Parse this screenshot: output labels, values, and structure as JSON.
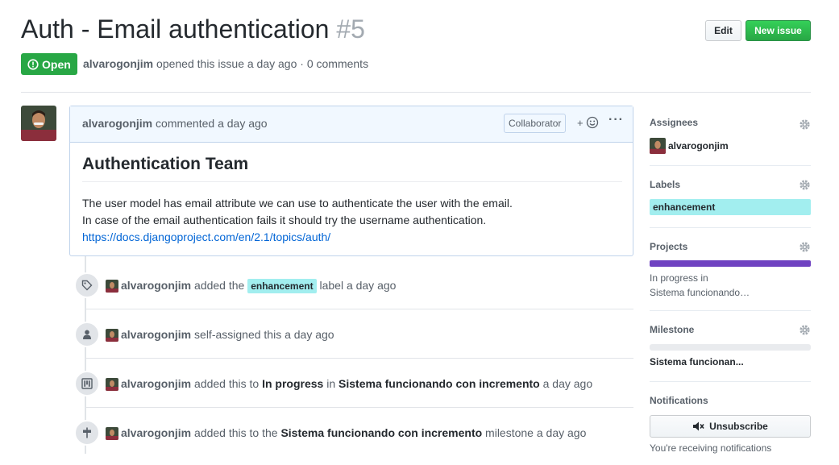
{
  "header": {
    "title": "Auth - Email authentication",
    "number": "#5",
    "edit_label": "Edit",
    "new_issue_label": "New issue",
    "state_label": "Open",
    "author": "alvarogonjim",
    "meta_text": "opened this issue a day ago · 0 comments"
  },
  "comment": {
    "author": "alvarogonjim",
    "meta": "commented a day ago",
    "role": "Collaborator",
    "react": "+",
    "heading": "Authentication Team",
    "line1": "The user model has email attribute we can use to authenticate the user with the email.",
    "line2": "In case of the email authentication fails it should try the username authentication.",
    "link": "https://docs.djangoproject.com/en/2.1/topics/auth/"
  },
  "timeline": [
    {
      "icon": "tag-icon",
      "user": "alvarogonjim",
      "pre": "added the",
      "label": "enhancement",
      "post": "label a day ago"
    },
    {
      "icon": "person-icon",
      "user": "alvarogonjim",
      "pre": "self-assigned this a day ago"
    },
    {
      "icon": "project-icon",
      "user": "alvarogonjim",
      "pre": "added this to",
      "b1": "In progress",
      "mid": "in",
      "b2": "Sistema funcionando con incremento",
      "post": "a day ago"
    },
    {
      "icon": "milestone-icon",
      "user": "alvarogonjim",
      "pre": "added this to the",
      "b1": "Sistema funcionando con incremento",
      "post": "milestone a day ago"
    }
  ],
  "sidebar": {
    "assignees_title": "Assignees",
    "assignee": "alvarogonjim",
    "labels_title": "Labels",
    "label": "enhancement",
    "projects_title": "Projects",
    "project_column": "In progress in",
    "project_name": "Sistema funcionando…",
    "milestone_title": "Milestone",
    "milestone_name": "Sistema funcionan...",
    "notifications_title": "Notifications",
    "unsubscribe_label": "Unsubscribe",
    "notif_text": "You're receiving notifications"
  },
  "colors": {
    "label_bg": "#a2eeef",
    "open_green": "#28a745",
    "project_purple": "#6f42c1"
  }
}
